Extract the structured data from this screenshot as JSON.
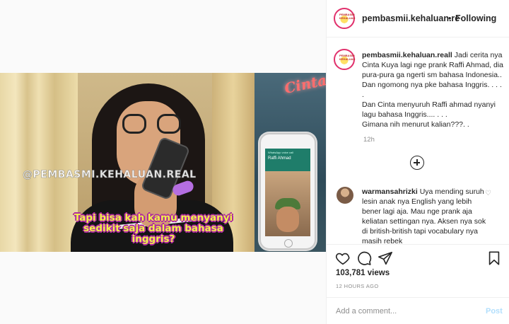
{
  "header": {
    "username": "pembasmii.kehaluan.re",
    "separator": "•",
    "follow_label": "Following"
  },
  "avatar_text": "PEMBASMI KEHALUAN",
  "caption": {
    "username": "pembasmii.kehaluan.reall",
    "text": "Jadi cerita nya Cinta Kuya lagi nge prank Raffi Ahmad, dia pura-pura ga ngerti sm bahasa Indonesia.. Dan ngomong nya pke bahasa Inggris. . . . .",
    "line2": "Dan Cinta menyuruh Raffi ahmad nyanyi lagu bahasa Inggris.... . . .",
    "line3": "Gimana nih menurut kalian???. .",
    "time": "12h"
  },
  "comment": {
    "username": "warmansahrizki",
    "text": "Uya mending suruh lesin anak nya English yang lebih bener lagi aja. Mau nge prank aja keliatan settingan nya. Aksen nya sok di british-british tapi vocabulary nya masih rebek"
  },
  "video": {
    "watermark": "@PEMBASMI.KEHALUAN.REAL",
    "subtitle": "Tapi bisa kah kamu menyanyi sedikit saja dalam bahasa inggris?",
    "neon_sign": "Cinta",
    "phone_caller": "Raffi Ahmad",
    "phone_status": "WhatsApp voice call"
  },
  "stats": {
    "views": "103,781 views",
    "posted": "12 HOURS AGO"
  },
  "add_comment": {
    "placeholder": "Add a comment...",
    "post_label": "Post"
  },
  "icons": [
    "heart-icon",
    "comment-icon",
    "share-icon",
    "bookmark-icon",
    "add-circle-icon",
    "small-heart-icon"
  ]
}
